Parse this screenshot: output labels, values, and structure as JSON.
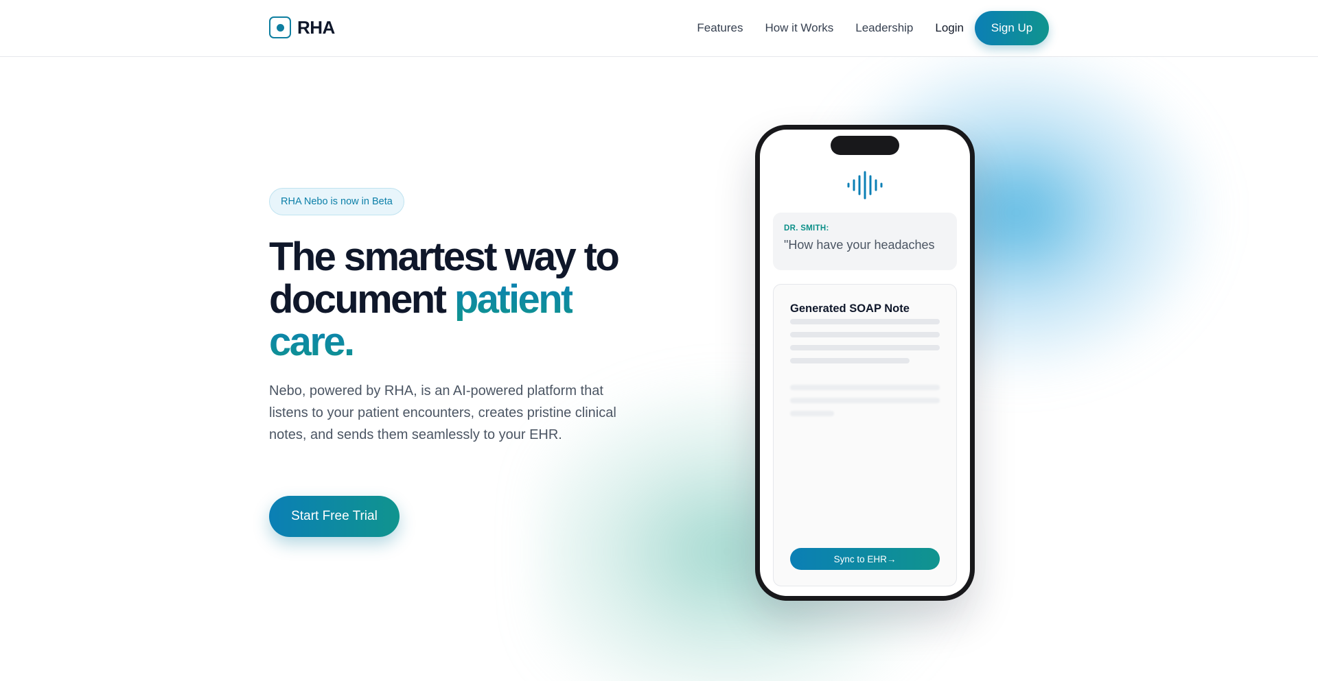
{
  "brand": {
    "name": "RHA",
    "accent_start": "#0b7fb5",
    "accent_end": "#10948e",
    "logo_icon": "square-dot-icon"
  },
  "nav": {
    "links": [
      "Features",
      "How it Works",
      "Leadership"
    ],
    "login": "Login",
    "signup": "Sign Up"
  },
  "hero": {
    "badge": "RHA Nebo is now in Beta",
    "headline_line1": "The smartest way to",
    "headline_line2": "document",
    "headline_highlight1": "patient",
    "headline_highlight2": "care.",
    "description": "Nebo, powered by RHA, is an AI-powered platform that listens to your patient encounters, creates pristine clinical notes, and sends them seamlessly to your EHR.",
    "cta": "Start Free Trial"
  },
  "phone": {
    "icon": "audio-waveform-icon",
    "speaker": "DR. SMITH:",
    "quote": "\"How have your headaches",
    "note_title": "Generated SOAP Note",
    "sync_button": "Sync to EHR→"
  }
}
